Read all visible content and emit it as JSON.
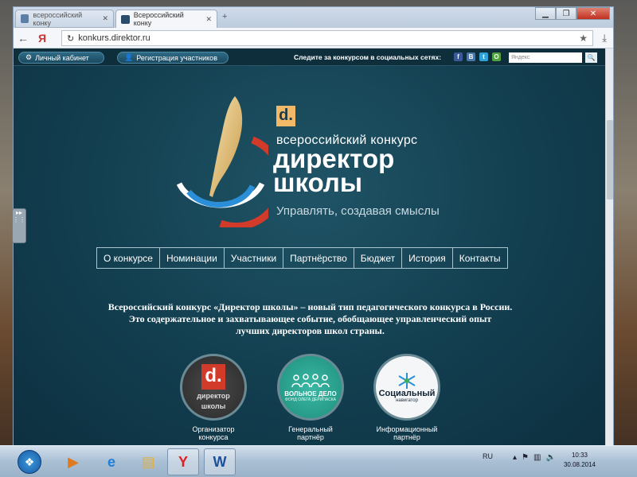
{
  "browser": {
    "tabs": [
      {
        "title": "всероссийский конку"
      },
      {
        "title": "Всероссийский конку"
      }
    ],
    "new_tab_glyph": "+",
    "window_controls": {
      "minimize": "▁",
      "maximize": "❐",
      "close": "✕"
    },
    "back_glyph": "←",
    "ya_glyph": "Я",
    "reload_glyph": "↻",
    "address": "konkurs.direktor.ru",
    "bookmark_glyph": "★",
    "download_glyph": "⤓"
  },
  "site": {
    "topbar": {
      "cabinet_label": "Личный кабинет",
      "register_label": "Регистрация участников",
      "social_label": "Следите за конкурсом в социальных сетях:",
      "social": [
        "f",
        "В",
        "t",
        "O"
      ],
      "search_placeholder": "Яндекс",
      "search_go": "🔍"
    },
    "logo": {
      "d_letter": "d.",
      "subtitle": "всероссийский конкурс",
      "title_line1": "директор",
      "title_line2": "школы",
      "tagline": "Управлять, создавая смыслы"
    },
    "menu": [
      "О конкурсе",
      "Номинации",
      "Участники",
      "Партнёрство",
      "Бюджет",
      "История",
      "Контакты"
    ],
    "intro": [
      "Всероссийский конкурс «Директор школы» – новый тип педагогического конкурса в России.",
      "Это содержательное и захватывающее событие, обобщающее управленческий опыт",
      "лучших директоров школ страны."
    ],
    "partners": [
      {
        "logo_letter": "d.",
        "logo_text1": "директор",
        "logo_text2": "школы",
        "caption1": "Организатор",
        "caption2": "конкурса"
      },
      {
        "logo_text1": "ВОЛЬНОЕ ДЕЛО",
        "logo_text2": "ФОНД ОЛЕГА ДЕРИПАСКА",
        "caption1": "Генеральный",
        "caption2": "партнёр"
      },
      {
        "logo_text1": "Социальный",
        "logo_text2": "навигатор",
        "caption1": "Информационный",
        "caption2": "партнёр"
      }
    ]
  },
  "taskbar": {
    "lang": "RU",
    "time": "10:33",
    "date": "30.08.2014",
    "apps": [
      "media-player",
      "internet-explorer",
      "file-explorer",
      "yandex-browser",
      "word"
    ]
  },
  "colors": {
    "page_bg": "#123e4f",
    "accent_orange": "#f1b868",
    "logo_red": "#d23a2a",
    "logo_blue": "#2a8fd8"
  }
}
